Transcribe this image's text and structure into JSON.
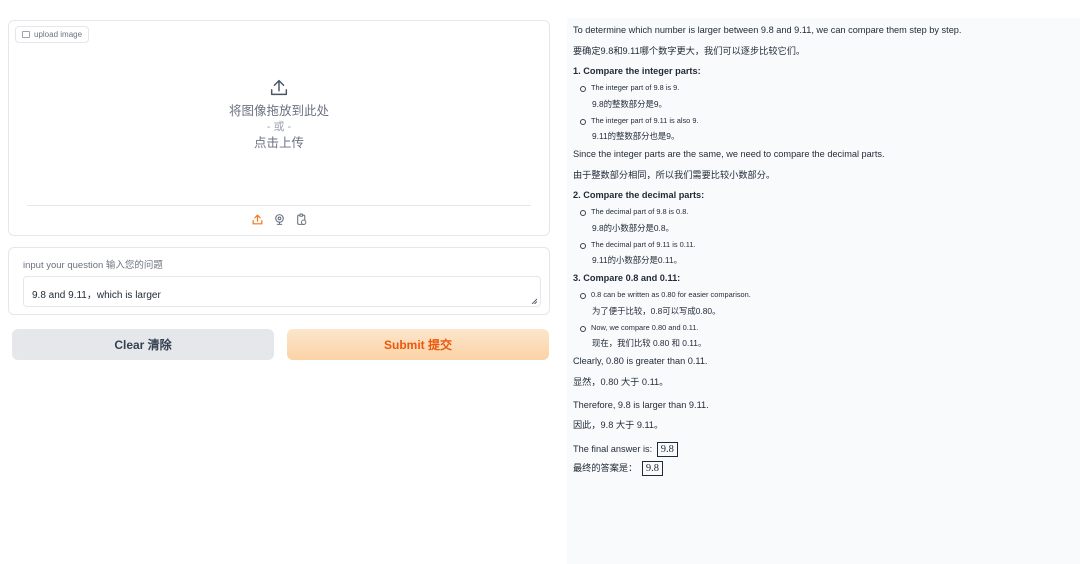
{
  "upload": {
    "tag_label": "upload image",
    "drop_text": "将图像拖放到此处",
    "or_text": "- 或 -",
    "click_text": "点击上传",
    "accent_color": "#f97316"
  },
  "question": {
    "label": "input your question 输入您的问题",
    "value": "9.8 and 9.11，which is larger"
  },
  "buttons": {
    "clear": "Clear 清除",
    "submit": "Submit 提交"
  },
  "answer": {
    "intro_en": "To determine which number is larger between 9.8 and 9.11, we can compare them step by step.",
    "intro_cn": "要确定9.8和9.11哪个数字更大，我们可以逐步比较它们。",
    "step1_title": "1. Compare the integer parts:",
    "step1_b1": "The integer part of 9.8 is 9.",
    "step1_b1_cn": "9.8的整数部分是9。",
    "step1_b2": "The integer part of 9.11 is also 9.",
    "step1_b2_cn": "9.11的整数部分也是9。",
    "same_en": "Since the integer parts are the same, we need to compare the decimal parts.",
    "same_cn": "由于整数部分相同，所以我们需要比较小数部分。",
    "step2_title": "2. Compare the decimal parts:",
    "step2_b1": "The decimal part of 9.8 is 0.8.",
    "step2_b1_cn": "9.8的小数部分是0.8。",
    "step2_b2": "The decimal part of 9.11 is 0.11.",
    "step2_b2_cn": "9.11的小数部分是0.11。",
    "step3_title": "3. Compare 0.8 and 0.11:",
    "step3_b1": "0.8 can be written as 0.80 for easier comparison.",
    "step3_b1_cn": "为了便于比较，0.8可以写成0.80。",
    "step3_b2": "Now, we compare 0.80 and 0.11.",
    "step3_b2_cn": "现在，我们比较 0.80 和 0.11。",
    "clearly_en": "Clearly, 0.80 is greater than 0.11.",
    "clearly_cn": "显然，0.80 大于 0.11。",
    "therefore_en": "Therefore, 9.8 is larger than 9.11.",
    "therefore_cn": "因此，9.8 大于 9.11。",
    "final_en_label": "The final answer is:",
    "final_cn_label": "最终的答案是：",
    "final_value": "9.8"
  }
}
